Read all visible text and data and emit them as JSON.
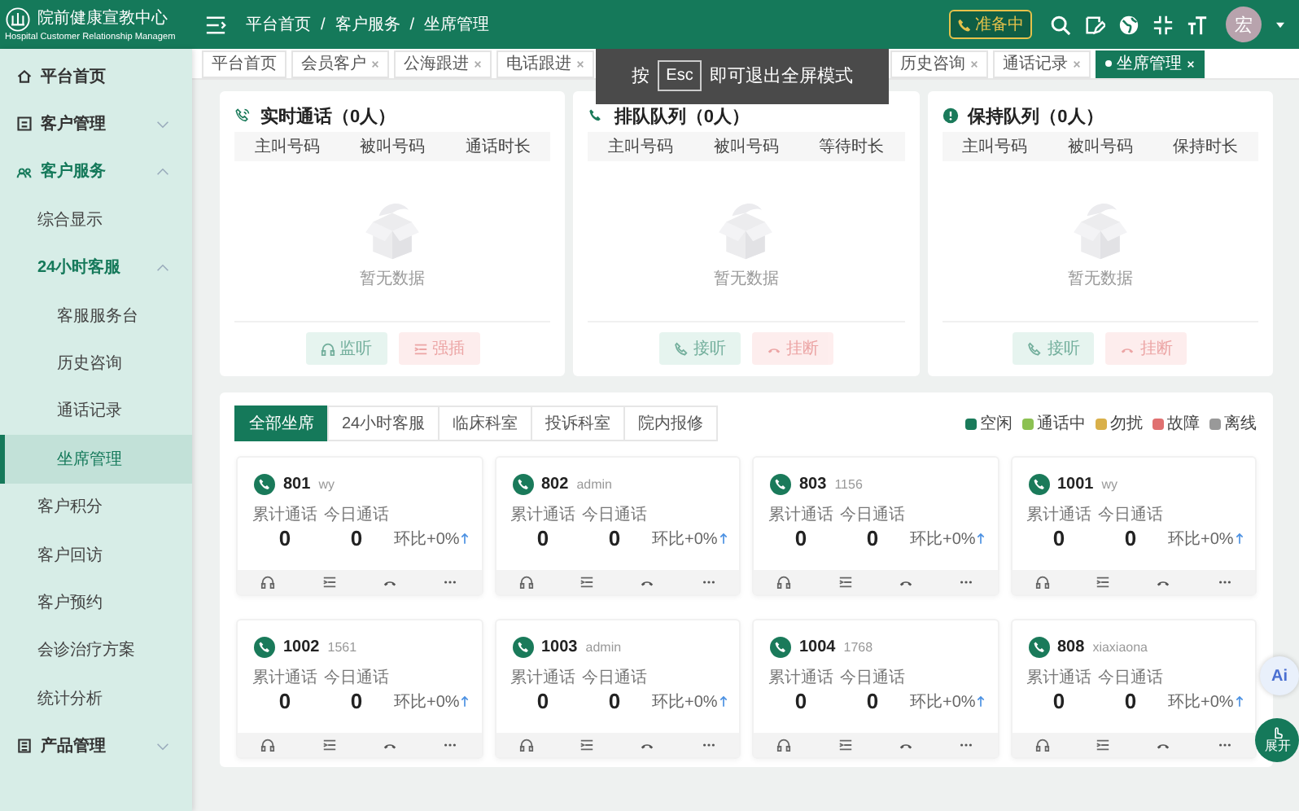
{
  "header": {
    "logo_title": "院前健康宣教中心",
    "logo_subtitle": "Hospital Customer Relationship Managem",
    "breadcrumbs": [
      "平台首页",
      "客户服务",
      "坐席管理"
    ],
    "separator": "/",
    "status_badge": "准备中",
    "avatar": "宏"
  },
  "sidebar": {
    "items": [
      {
        "label": "平台首页",
        "expanded": false,
        "selected": false
      },
      {
        "label": "客户管理",
        "expanded": false,
        "selected": false
      },
      {
        "label": "客户服务",
        "expanded": true,
        "selected": false,
        "children": [
          {
            "label": "综合显示",
            "expanded": false,
            "selected": false
          },
          {
            "label": "24小时客服",
            "expanded": true,
            "selected": false,
            "children": [
              {
                "label": "客服服务台",
                "selected": false
              },
              {
                "label": "历史咨询",
                "selected": false
              },
              {
                "label": "通话记录",
                "selected": false
              },
              {
                "label": "坐席管理",
                "selected": true
              }
            ]
          },
          {
            "label": "客户积分",
            "expanded": false,
            "selected": false
          },
          {
            "label": "客户回访",
            "expanded": false,
            "selected": false
          },
          {
            "label": "客户预约",
            "expanded": false,
            "selected": false
          },
          {
            "label": "会诊治疗方案",
            "expanded": false,
            "selected": false
          },
          {
            "label": "统计分析",
            "expanded": false,
            "selected": false
          }
        ]
      },
      {
        "label": "产品管理",
        "expanded": false,
        "selected": false
      }
    ]
  },
  "tabs": [
    {
      "label": "平台首页",
      "selected": false
    },
    {
      "label": "会员客户",
      "selected": false
    },
    {
      "label": "公海跟进",
      "selected": false
    },
    {
      "label": "电话跟进",
      "selected": false
    },
    {
      "label": "历史咨询",
      "selected": false
    },
    {
      "label": "通话记录",
      "selected": false
    },
    {
      "label": "坐席管理",
      "selected": true
    }
  ],
  "fullscreen_hint": {
    "before": "按",
    "key": "Esc",
    "after": "即可退出全屏模式"
  },
  "queues": [
    {
      "kind": "live",
      "title": "实时通话（0人）",
      "columns": [
        "主叫号码",
        "被叫号码",
        "通话时长"
      ],
      "empty_text": "暂无数据",
      "buttons": [
        {
          "kind": "listen",
          "label": "监听",
          "disabled": true
        },
        {
          "kind": "barge",
          "label": "强插",
          "disabled": true
        }
      ]
    },
    {
      "kind": "queue",
      "title": "排队队列（0人）",
      "columns": [
        "主叫号码",
        "被叫号码",
        "等待时长"
      ],
      "empty_text": "暂无数据",
      "buttons": [
        {
          "kind": "answer",
          "label": "接听",
          "disabled": true
        },
        {
          "kind": "hangup",
          "label": "挂断",
          "disabled": true
        }
      ]
    },
    {
      "kind": "hold",
      "title": "保持队列（0人）",
      "columns": [
        "主叫号码",
        "被叫号码",
        "保持时长"
      ],
      "empty_text": "暂无数据",
      "buttons": [
        {
          "kind": "answer",
          "label": "接听",
          "disabled": true
        },
        {
          "kind": "hangup",
          "label": "挂断",
          "disabled": true
        }
      ]
    }
  ],
  "agent_filters": [
    {
      "label": "全部坐席",
      "selected": true
    },
    {
      "label": "24小时客服",
      "selected": false
    },
    {
      "label": "临床科室",
      "selected": false
    },
    {
      "label": "投诉科室",
      "selected": false
    },
    {
      "label": "院内报修",
      "selected": false
    }
  ],
  "legend": [
    {
      "label": "空闲",
      "color": "#1a7a5a"
    },
    {
      "label": "通话中",
      "color": "#8cc152"
    },
    {
      "label": "勿扰",
      "color": "#d9b04a"
    },
    {
      "label": "故障",
      "color": "#e07070"
    },
    {
      "label": "离线",
      "color": "#999999"
    }
  ],
  "agents": [
    {
      "ext": "801",
      "user": "wy",
      "color": "#1a7a5a",
      "total_label": "累计通话",
      "today_label": "今日通话",
      "total": "0",
      "today": "0",
      "trend": "环比+0%"
    },
    {
      "ext": "802",
      "user": "admin",
      "color": "#1a7a5a",
      "total_label": "累计通话",
      "today_label": "今日通话",
      "total": "0",
      "today": "0",
      "trend": "环比+0%"
    },
    {
      "ext": "803",
      "user": "1156",
      "color": "#1a7a5a",
      "total_label": "累计通话",
      "today_label": "今日通话",
      "total": "0",
      "today": "0",
      "trend": "环比+0%"
    },
    {
      "ext": "1001",
      "user": "wy",
      "color": "#1a7a5a",
      "total_label": "累计通话",
      "today_label": "今日通话",
      "total": "0",
      "today": "0",
      "trend": "环比+0%"
    },
    {
      "ext": "1002",
      "user": "1561",
      "color": "#1a7a5a",
      "total_label": "累计通话",
      "today_label": "今日通话",
      "total": "0",
      "today": "0",
      "trend": "环比+0%"
    },
    {
      "ext": "1003",
      "user": "admin",
      "color": "#1a7a5a",
      "total_label": "累计通话",
      "today_label": "今日通话",
      "total": "0",
      "today": "0",
      "trend": "环比+0%"
    },
    {
      "ext": "1004",
      "user": "1768",
      "color": "#1a7a5a",
      "total_label": "累计通话",
      "today_label": "今日通话",
      "total": "0",
      "today": "0",
      "trend": "环比+0%"
    },
    {
      "ext": "808",
      "user": "xiaxiaona",
      "color": "#1a7a5a",
      "total_label": "累计通话",
      "today_label": "今日通话",
      "total": "0",
      "today": "0",
      "trend": "环比+0%"
    }
  ],
  "float_buttons": {
    "ai": "Ai",
    "expand": "展开"
  }
}
